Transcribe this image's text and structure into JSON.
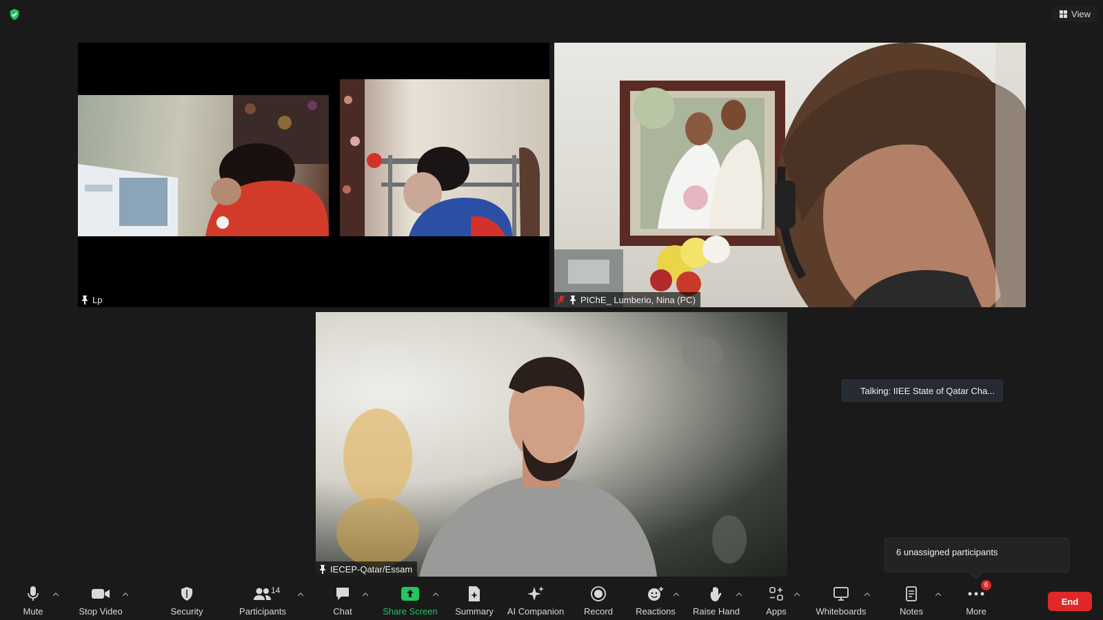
{
  "top_bar": {
    "view_label": "View"
  },
  "tiles": {
    "lp": {
      "name": "Lp"
    },
    "nina": {
      "name": "PIChE_ Lumberio, Nina (PC)"
    },
    "essam": {
      "name": "IECEP-Qatar/Essam"
    }
  },
  "talking_indicator": {
    "text": "Talking: IIEE State of Qatar Cha..."
  },
  "unassigned_popup": {
    "text": "6 unassigned participants"
  },
  "toolbar": {
    "mute": "Mute",
    "stop_video": "Stop Video",
    "security": "Security",
    "participants": "Participants",
    "participants_count": "14",
    "chat": "Chat",
    "share_screen": "Share Screen",
    "summary": "Summary",
    "ai_companion": "AI Companion",
    "record": "Record",
    "reactions": "Reactions",
    "raise_hand": "Raise Hand",
    "apps": "Apps",
    "whiteboards": "Whiteboards",
    "notes": "Notes",
    "more": "More",
    "more_badge": "6",
    "end": "End"
  },
  "colors": {
    "accent_green": "#22c55e",
    "end_red": "#e02828",
    "background": "#1a1a1a"
  }
}
